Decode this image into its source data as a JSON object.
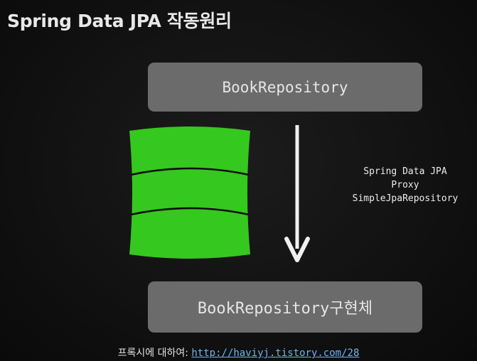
{
  "title": "Spring Data JPA 작동원리",
  "top_box_label": "BookRepository",
  "bottom_box_label": "BookRepository구현체",
  "proxy_lines": [
    "Spring Data JPA",
    "Proxy",
    "SimpleJpaRepository"
  ],
  "footer": {
    "prefix": "프록시에 대하여:",
    "link": "http://haviyj.tistory.com/28"
  },
  "icons": {
    "database": "database-icon",
    "arrow": "arrow-down-icon"
  },
  "colors": {
    "box": "#6b6b6b",
    "database": "#35c81e",
    "link": "#6fb3f0"
  }
}
